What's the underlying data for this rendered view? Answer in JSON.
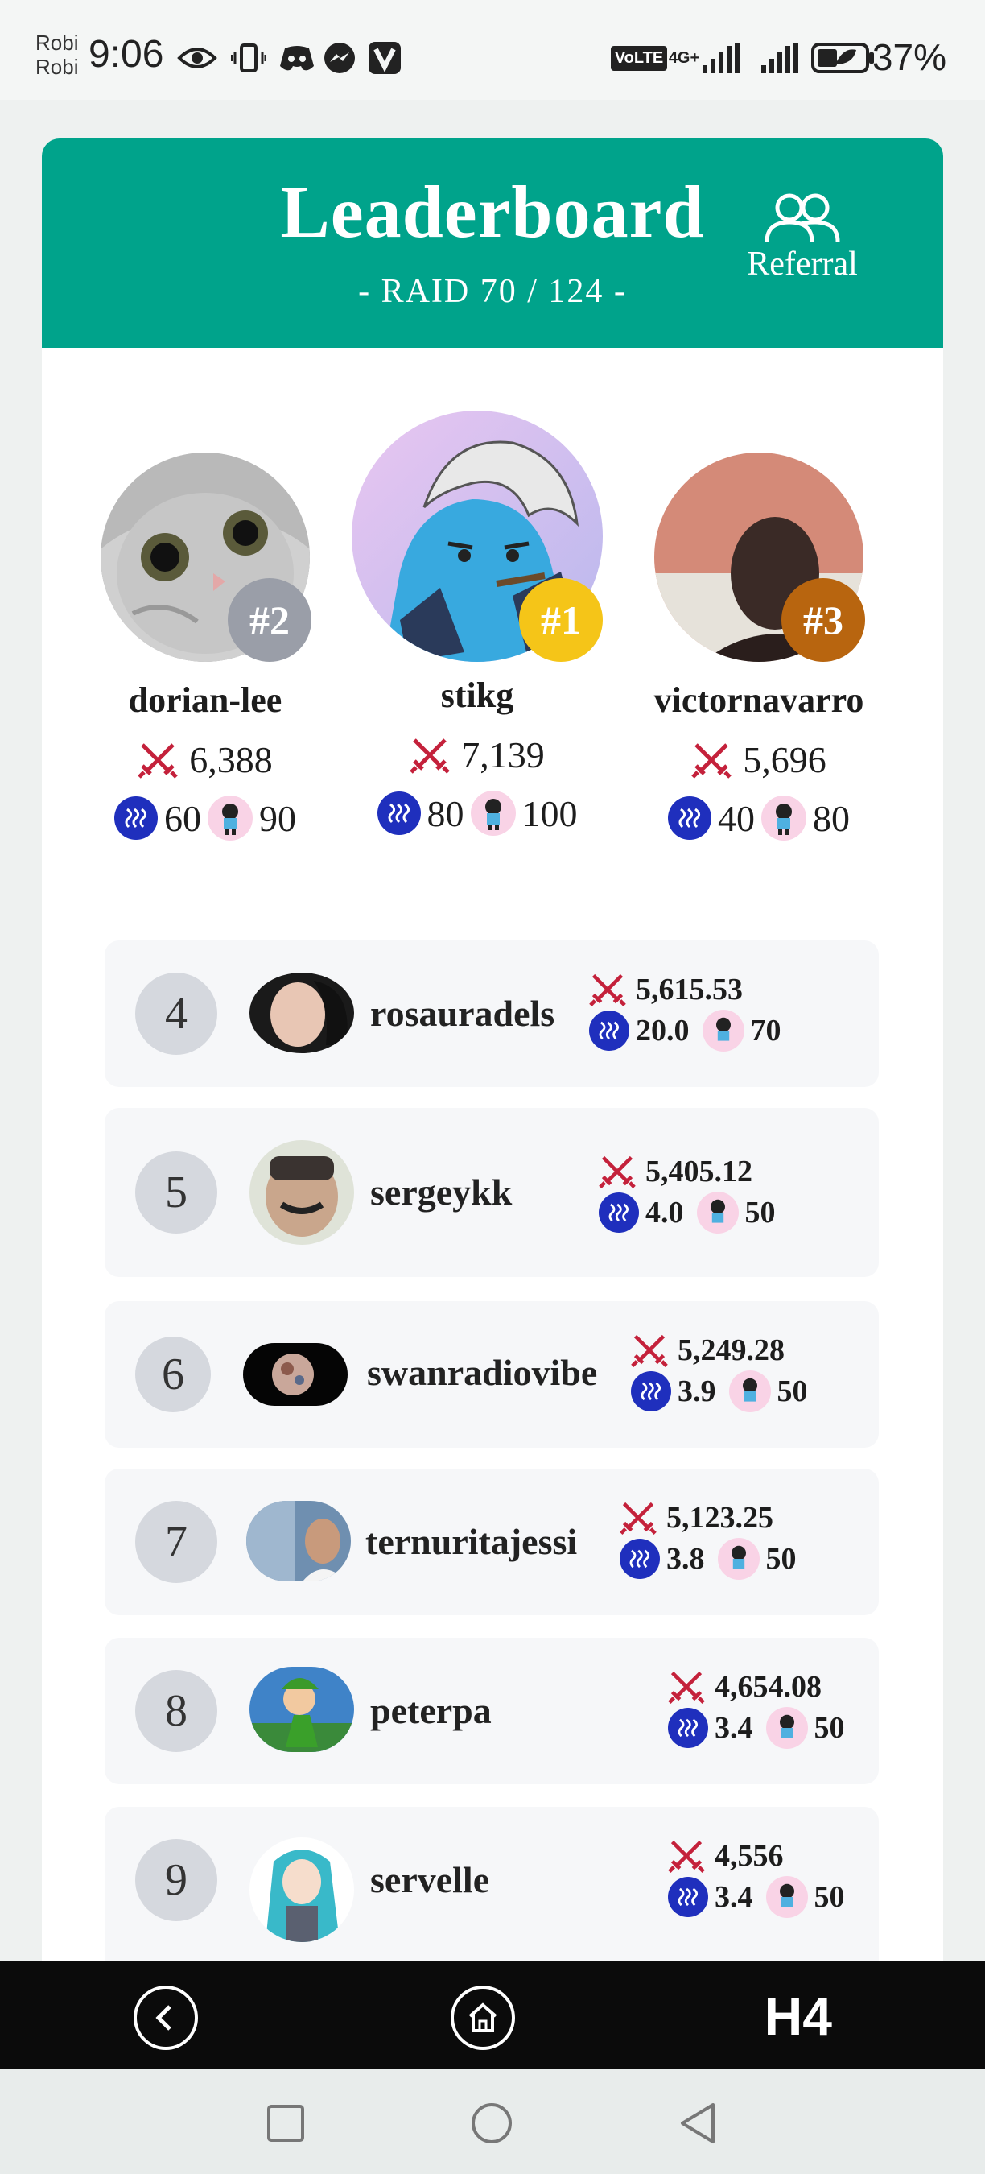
{
  "status_bar": {
    "carrier_line1": "Robi",
    "carrier_line2": "Robi",
    "time": "9:06",
    "network": "4G+",
    "volte": "VoLTE",
    "battery": "37%"
  },
  "header": {
    "title": "Leaderboard",
    "subtitle": "- RAID 70 / 124 -",
    "referral_label": "Referral"
  },
  "podium": [
    {
      "rank": "#2",
      "name": "dorian-lee",
      "score": "6,388",
      "steem": "60",
      "mascot": "90",
      "rank_color": "#9a9ea8",
      "avatar_icon": "cat-avatar"
    },
    {
      "rank": "#1",
      "name": "stikg",
      "score": "7,139",
      "steem": "80",
      "mascot": "100",
      "rank_color": "#f5c518",
      "avatar_icon": "cartoon-avatar"
    },
    {
      "rank": "#3",
      "name": "victornavarro",
      "score": "5,696",
      "steem": "40",
      "mascot": "80",
      "rank_color": "#b8650f",
      "avatar_icon": "photo-avatar"
    }
  ],
  "rows": [
    {
      "rank": "4",
      "name": "rosauradels",
      "score": "5,615.53",
      "steem": "20.0",
      "mascot": "70"
    },
    {
      "rank": "5",
      "name": "sergeykk",
      "score": "5,405.12",
      "steem": "4.0",
      "mascot": "50"
    },
    {
      "rank": "6",
      "name": "swanradiovibe",
      "score": "5,249.28",
      "steem": "3.9",
      "mascot": "50"
    },
    {
      "rank": "7",
      "name": "ternuritajessi",
      "score": "5,123.25",
      "steem": "3.8",
      "mascot": "50"
    },
    {
      "rank": "8",
      "name": "peterpa",
      "score": "4,654.08",
      "steem": "3.4",
      "mascot": "50"
    },
    {
      "rank": "9",
      "name": "servelle",
      "score": "4,556",
      "steem": "3.4",
      "mascot": "50"
    }
  ],
  "app_nav": {
    "logo": "H4"
  },
  "colors": {
    "header": "#00a38b",
    "steem": "#1f2fbd",
    "sword": "#c4213b"
  }
}
